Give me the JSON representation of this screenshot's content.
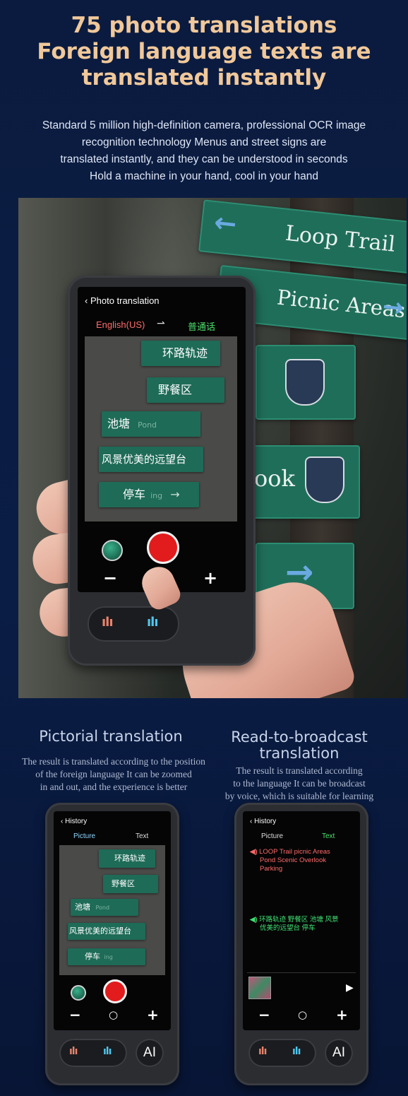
{
  "headline": {
    "line1": "75 photo translations",
    "line2": "Foreign language texts are",
    "line3": "translated instantly"
  },
  "description": {
    "line1": "Standard 5 million high-definition camera, professional OCR image",
    "line2": "recognition technology Menus and street signs are",
    "line3": "translated instantly, and they can be understood in seconds",
    "line4": "Hold a machine in your hand, cool in your hand"
  },
  "scene_signs": {
    "loop": "Loop Trail",
    "picnic": "Picnic Areas",
    "overlook": "ook"
  },
  "main_device": {
    "back_glyph": "‹",
    "title": "Photo translation",
    "source_lang": "English(US)",
    "swap_glyph": "⇀",
    "target_lang": "普通话",
    "translated_signs": [
      "环路轨迹",
      "野餐区",
      "池塘",
      "风景优美的远望台",
      "停车"
    ],
    "faded_signs": [
      "Pond",
      "ing"
    ],
    "zoom_out": "−",
    "zoom_in": "+",
    "arrow_glyph": "→"
  },
  "pictorial": {
    "title": "Pictorial translation",
    "desc_line1": "The result is translated according to the position",
    "desc_line2": "of the foreign language It can be zoomed",
    "desc_line3": "in and out, and the experience is better",
    "device": {
      "back_glyph": "‹",
      "title": "History",
      "tab_picture": "Picture",
      "tab_text": "Text",
      "translated_signs": [
        "环路轨迹",
        "野餐区",
        "池塘",
        "风景优美的远望台",
        "停车"
      ],
      "faded_signs": [
        "Pond",
        "ing"
      ],
      "zoom_out": "−",
      "zoom_mid": "○",
      "zoom_in": "+",
      "ai_label": "AI"
    }
  },
  "broadcast": {
    "title_line1": "Read-to-broadcast",
    "title_line2": "translation",
    "desc_line1": "The result is translated according",
    "desc_line2": "to the language It can be broadcast",
    "desc_line3": "by voice, which is suitable for learning",
    "device": {
      "back_glyph": "‹",
      "title": "History",
      "tab_picture": "Picture",
      "tab_text": "Text",
      "speaker_glyph": "◀)",
      "source_line1": "LOOP Trail picnic Areas",
      "source_line2": "Pond Scenic Overlook",
      "source_line3": "Parking",
      "target_line1": "环路轨迹 野餐区 池塘 风景",
      "target_line2": "优美的远望台 停车",
      "play_glyph": "▶",
      "zoom_out": "−",
      "zoom_mid": "○",
      "zoom_in": "+",
      "ai_label": "AI"
    }
  },
  "colors": {
    "headline": "#f0c89a",
    "source_lang": "#ff6b6b",
    "target_lang": "#49e06c",
    "shutter": "#e21c1c",
    "sign_green": "#1f6e5a"
  },
  "icons": [
    "back-chevron-icon",
    "swap-arrow-icon",
    "shutter-button-icon",
    "gallery-thumb-icon",
    "mic-wave-icon",
    "speaker-icon",
    "play-icon"
  ]
}
